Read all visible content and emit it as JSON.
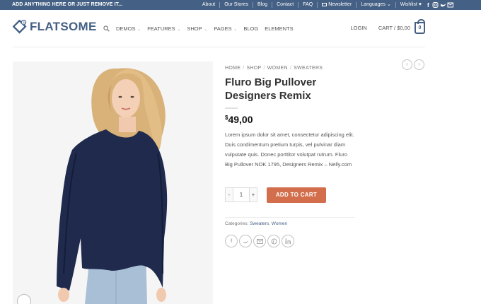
{
  "topbar": {
    "promo": "ADD ANYTHING HERE OR JUST REMOVE IT...",
    "links": [
      "About",
      "Our Stores",
      "Blog",
      "Contact",
      "FAQ"
    ],
    "newsletter": "Newsletter",
    "languages": "Languages",
    "wishlist": "Wishlist"
  },
  "header": {
    "logo_text": "FLATSOME",
    "nav": [
      {
        "label": "DEMOS",
        "dropdown": true
      },
      {
        "label": "FEATURES",
        "dropdown": true
      },
      {
        "label": "SHOP",
        "dropdown": true
      },
      {
        "label": "PAGES",
        "dropdown": true
      },
      {
        "label": "BLOG",
        "dropdown": false
      },
      {
        "label": "ELEMENTS",
        "dropdown": false
      }
    ],
    "login": "LOGIN",
    "cart_label": "CART / $0,00",
    "cart_count": "0"
  },
  "product": {
    "breadcrumb": [
      "HOME",
      "SHOP",
      "WOMEN",
      "SWEATERS"
    ],
    "title": "Fluro Big Pullover Designers Remix",
    "price_currency": "$",
    "price_value": "49,00",
    "description": "Lorem ipsum dolor sit amet, consectetur adipiscing elit. Duis condimentum pretium turpis, vel pulvinar diam vulputate quis. Donec porttitor volutpat rutrum. Fluro Big Pullover NOK 1795, Designers Remix – Nelly.com",
    "qty_minus": "-",
    "qty_value": "1",
    "qty_plus": "+",
    "add_to_cart": "ADD TO CART",
    "categories_label": "Categories:",
    "categories": [
      "Sweaters",
      "Women"
    ]
  },
  "colors": {
    "primary": "#446084",
    "accent": "#d26e4b",
    "sweater": "#1f2a4d"
  },
  "icons": [
    "search-icon",
    "cart-icon",
    "heart-icon",
    "facebook-icon",
    "instagram-icon",
    "twitter-icon",
    "email-icon",
    "pinterest-icon",
    "linkedin-icon",
    "zoom-icon",
    "prev-icon",
    "next-icon"
  ]
}
